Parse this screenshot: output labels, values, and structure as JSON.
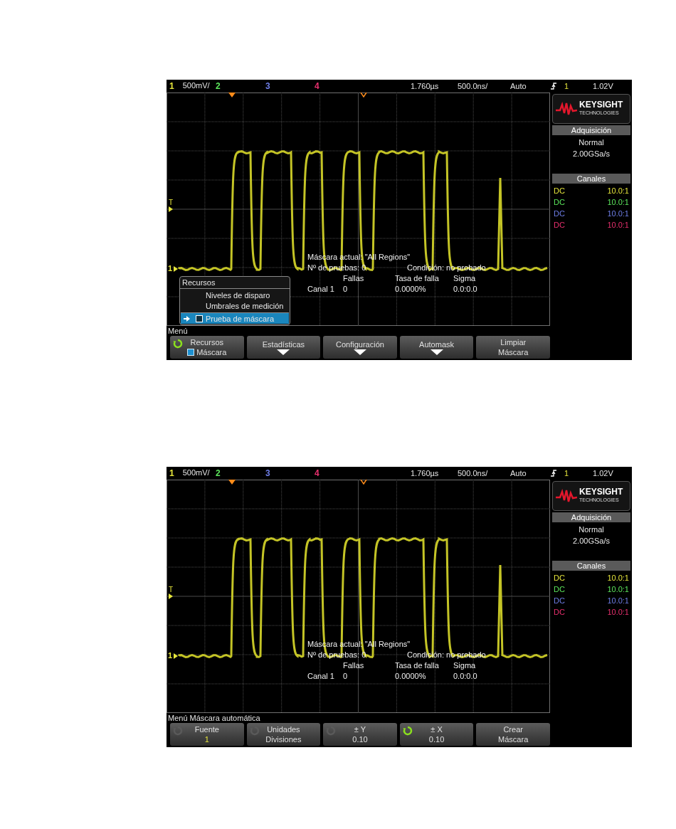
{
  "screens": [
    {
      "header": {
        "channels": [
          {
            "label": "1",
            "scale": "500mV/",
            "color": "#e6e63c"
          },
          {
            "label": "2",
            "color": "#5ce65c"
          },
          {
            "label": "3",
            "color": "#6f7fe8"
          },
          {
            "label": "4",
            "color": "#e8306e"
          }
        ],
        "delay": "1.760µs",
        "timebase": "500.0ns/",
        "trigger_mode": "Auto",
        "trigger_source": "1",
        "trigger_level": "1.02V"
      },
      "brand": {
        "name": "KEYSIGHT",
        "sub": "TECHNOLOGIES"
      },
      "acquisition": {
        "title": "Adquisición",
        "mode": "Normal",
        "rate": "2.00GSa/s"
      },
      "channels_panel": {
        "title": "Canales",
        "channels": [
          {
            "coupling": "DC",
            "probe": "10.0:1",
            "color": "#e6e63c"
          },
          {
            "coupling": "DC",
            "probe": "10.0:1",
            "color": "#5ce65c"
          },
          {
            "coupling": "DC",
            "probe": "10.0:1",
            "color": "#6f7fe8"
          },
          {
            "coupling": "DC",
            "probe": "10.0:1",
            "color": "#e8306e"
          }
        ]
      },
      "ground_marker": "1",
      "trigger_marker": "T",
      "mask_info": {
        "title": "Máscara actual: \"All Regions\"",
        "tests": "Nº de pruebas: 0",
        "status": "Condición: no probado",
        "columns": [
          "Fallas",
          "Tasa de falla",
          "Sigma"
        ],
        "row": [
          "Canal 1",
          "0",
          "0.0000%",
          "0.0:0.0"
        ]
      },
      "popup": {
        "title": "Recursos",
        "items": [
          {
            "label": "Niveles de disparo",
            "kind": "plain",
            "selected": false
          },
          {
            "label": "Umbrales de medición",
            "kind": "plain",
            "selected": false
          },
          {
            "label": "Prueba de máscara",
            "kind": "checkbox",
            "checked": false,
            "selected": true
          }
        ]
      },
      "menu_title": "Menú",
      "softkeys": [
        {
          "label": "Recursos",
          "value": "Máscara",
          "kind": "checkbox-value",
          "checked": true,
          "knob_active": true
        },
        {
          "label": "Estadísticas",
          "kind": "submenu"
        },
        {
          "label": "Configuración",
          "kind": "submenu"
        },
        {
          "label": "Automask",
          "kind": "submenu"
        },
        {
          "label": "Limpiar",
          "value": "Máscara",
          "kind": "value"
        }
      ]
    },
    {
      "header": {
        "channels": [
          {
            "label": "1",
            "scale": "500mV/",
            "color": "#e6e63c"
          },
          {
            "label": "2",
            "color": "#5ce65c"
          },
          {
            "label": "3",
            "color": "#6f7fe8"
          },
          {
            "label": "4",
            "color": "#e8306e"
          }
        ],
        "delay": "1.760µs",
        "timebase": "500.0ns/",
        "trigger_mode": "Auto",
        "trigger_source": "1",
        "trigger_level": "1.02V"
      },
      "brand": {
        "name": "KEYSIGHT",
        "sub": "TECHNOLOGIES"
      },
      "acquisition": {
        "title": "Adquisición",
        "mode": "Normal",
        "rate": "2.00GSa/s"
      },
      "channels_panel": {
        "title": "Canales",
        "channels": [
          {
            "coupling": "DC",
            "probe": "10.0:1",
            "color": "#e6e63c"
          },
          {
            "coupling": "DC",
            "probe": "10.0:1",
            "color": "#5ce65c"
          },
          {
            "coupling": "DC",
            "probe": "10.0:1",
            "color": "#6f7fe8"
          },
          {
            "coupling": "DC",
            "probe": "10.0:1",
            "color": "#e8306e"
          }
        ]
      },
      "ground_marker": "1",
      "trigger_marker": "T",
      "mask_info": {
        "title": "Máscara actual: \"All Regions\"",
        "tests": "Nº de pruebas: 0",
        "status": "Condición: no probado",
        "columns": [
          "Fallas",
          "Tasa de falla",
          "Sigma"
        ],
        "row": [
          "Canal 1",
          "0",
          "0.0000%",
          "0.0:0.0"
        ]
      },
      "menu_title": "Menú Máscara automática",
      "softkeys": [
        {
          "label": "Fuente",
          "value": "1",
          "kind": "channel-value",
          "knob_active": false
        },
        {
          "label": "Unidades",
          "value": "Divisiones",
          "kind": "value",
          "knob_active": false
        },
        {
          "label": "± Y",
          "value": "0.10",
          "kind": "value",
          "knob_active": false
        },
        {
          "label": "± X",
          "value": "0.10",
          "kind": "value",
          "knob_active": true
        },
        {
          "label": "Crear",
          "value": "Máscara",
          "kind": "value"
        }
      ]
    }
  ]
}
